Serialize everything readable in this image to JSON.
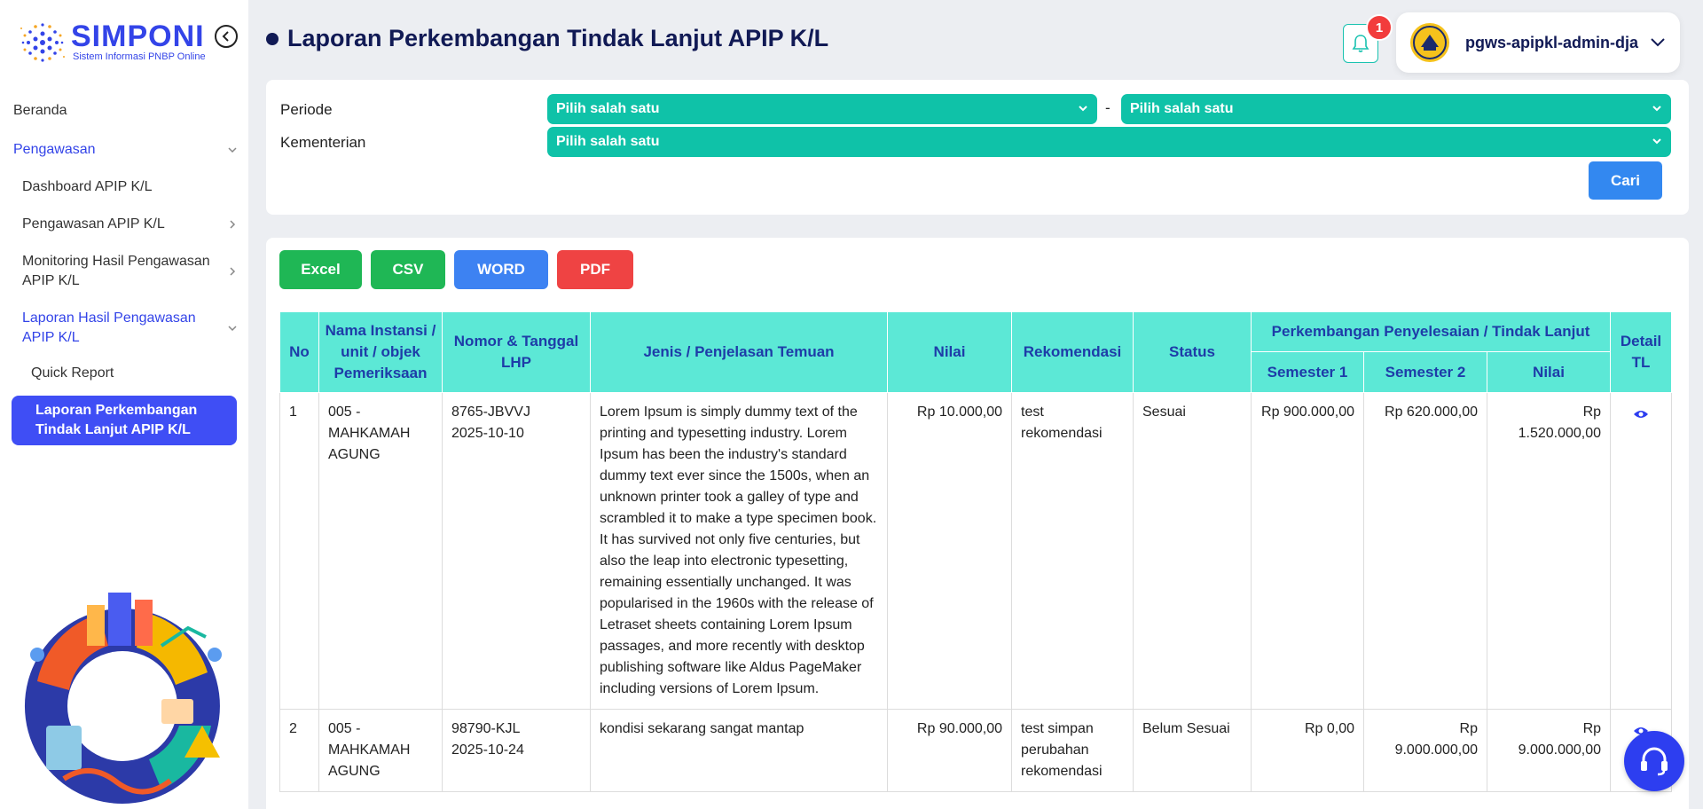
{
  "brand": {
    "name": "SIMPONI",
    "subtitle": "Sistem Informasi PNBP Online"
  },
  "sidebar": {
    "beranda": "Beranda",
    "group": "Pengawasan",
    "items": [
      "Dashboard APIP K/L",
      "Pengawasan APIP K/L",
      "Monitoring Hasil Pengawasan APIP K/L",
      "Laporan Hasil Pengawasan APIP K/L"
    ],
    "sub_items": [
      "Quick Report",
      "Laporan Perkembangan Tindak Lanjut APIP K/L"
    ]
  },
  "header": {
    "title": "Laporan Perkembangan Tindak Lanjut APIP K/L",
    "notification_count": "1",
    "username": "pgws-apipkl-admin-dja"
  },
  "filters": {
    "periode_label": "Periode",
    "kementerian_label": "Kementerian",
    "select_placeholder": "Pilih salah satu",
    "dash": "-",
    "search_button": "Cari"
  },
  "export": {
    "excel": "Excel",
    "csv": "CSV",
    "word": "WORD",
    "pdf": "PDF"
  },
  "table": {
    "headers": {
      "no": "No",
      "instansi": "Nama Instansi / unit / objek Pemeriksaan",
      "lhp": "Nomor & Tanggal LHP",
      "temuan": "Jenis / Penjelasan Temuan",
      "nilai": "Nilai",
      "rekomendasi": "Rekomendasi",
      "status": "Status",
      "perkembangan": "Perkembangan Penyelesaian / Tindak Lanjut",
      "semester1": "Semester 1",
      "semester2": "Semester 2",
      "nilai_tl": "Nilai",
      "detail": "Detail TL"
    },
    "rows": [
      {
        "no": "1",
        "instansi": "005 - MAHKAMAH AGUNG",
        "lhp_no": "8765-JBVVJ",
        "lhp_date": "2025-10-10",
        "temuan": "Lorem Ipsum is simply dummy text of the printing and typesetting industry. Lorem Ipsum has been the industry's standard dummy text ever since the 1500s, when an unknown printer took a galley of type and scrambled it to make a type specimen book. It has survived not only five centuries, but also the leap into electronic typesetting, remaining essentially unchanged. It was popularised in the 1960s with the release of Letraset sheets containing Lorem Ipsum passages, and more recently with desktop publishing software like Aldus PageMaker including versions of Lorem Ipsum.",
        "nilai": "Rp 10.000,00",
        "rekomendasi": "test rekomendasi",
        "status": "Sesuai",
        "semester1": "Rp 900.000,00",
        "semester2": "Rp 620.000,00",
        "nilai_tl": "Rp 1.520.000,00"
      },
      {
        "no": "2",
        "instansi": "005 - MAHKAMAH AGUNG",
        "lhp_no": "98790-KJL",
        "lhp_date": "2025-10-24",
        "temuan": "kondisi sekarang sangat mantap",
        "nilai": "Rp 90.000,00",
        "rekomendasi": "test simpan perubahan rekomendasi",
        "status": "Belum Sesuai",
        "semester1": "Rp 0,00",
        "semester2": "Rp 9.000.000,00",
        "nilai_tl": "Rp 9.000.000,00"
      }
    ]
  },
  "colors": {
    "brand_blue": "#3344e8",
    "teal": "#0fc2a8",
    "header_teal": "#5ce8d6",
    "navy": "#111a55"
  }
}
